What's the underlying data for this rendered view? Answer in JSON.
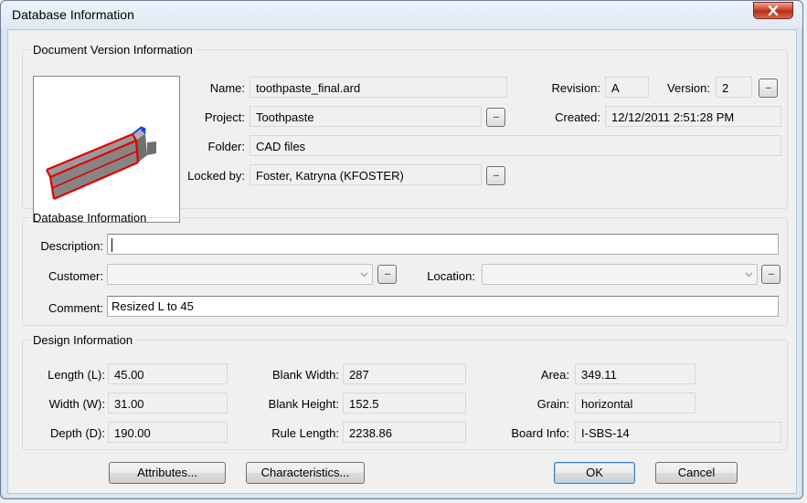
{
  "window": {
    "title": "Database Information"
  },
  "version_info": {
    "legend": "Document Version Information",
    "name_label": "Name:",
    "name": "toothpaste_final.ard",
    "project_label": "Project:",
    "project": "Toothpaste",
    "folder_label": "Folder:",
    "folder": "CAD files",
    "locked_label": "Locked by:",
    "locked_by": "Foster, Katryna (KFOSTER)",
    "revision_label": "Revision:",
    "revision": "A",
    "version_label": "Version:",
    "version": "2",
    "created_label": "Created:",
    "created": "12/12/2011 2:51:28 PM"
  },
  "db_info": {
    "legend": "Database Information",
    "description_label": "Description:",
    "description": "",
    "customer_label": "Customer:",
    "customer": "",
    "location_label": "Location:",
    "location": "",
    "comment_label": "Comment:",
    "comment": "Resized L to 45"
  },
  "design_info": {
    "legend": "Design Information",
    "length_label": "Length (L):",
    "length": "45.00",
    "width_label": "Width (W):",
    "width": "31.00",
    "depth_label": "Depth (D):",
    "depth": "190.00",
    "blank_width_label": "Blank Width:",
    "blank_width": "287",
    "blank_height_label": "Blank Height:",
    "blank_height": "152.5",
    "rule_length_label": "Rule Length:",
    "rule_length": "2238.86",
    "area_label": "Area:",
    "area": "349.11",
    "grain_label": "Grain:",
    "grain": "horizontal",
    "board_info_label": "Board Info:",
    "board_info": "I-SBS-14"
  },
  "buttons": {
    "ellipsis": "...",
    "attributes": "Attributes...",
    "characteristics": "Characteristics...",
    "ok": "OK",
    "cancel": "Cancel"
  },
  "icons": {
    "close": "close-x-icon",
    "dropdown": "chevron-down-icon",
    "preview": "3d-box-preview"
  },
  "colors": {
    "close_button": "#c9452f",
    "titlebar": "#dfe8f3",
    "preview_outline": "#e00000"
  }
}
